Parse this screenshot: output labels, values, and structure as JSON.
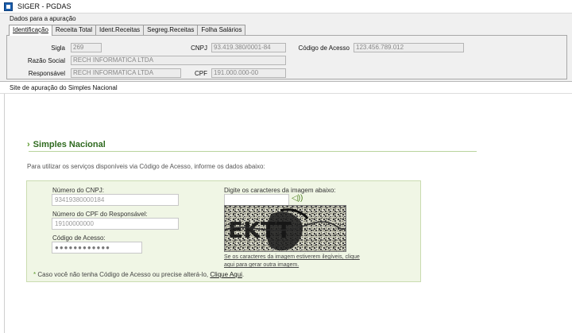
{
  "window": {
    "title": "SIGER - PGDAS"
  },
  "panel": {
    "group_label": "Dados para a apuração",
    "tabs": [
      {
        "label": "Identificação",
        "active": true
      },
      {
        "label": "Receita Total",
        "active": false
      },
      {
        "label": "Ident.Receitas",
        "active": false
      },
      {
        "label": "Segreg.Receitas",
        "active": false
      },
      {
        "label": "Folha Salários",
        "active": false
      }
    ],
    "fields": {
      "sigla": {
        "label": "Sigla",
        "value": "269"
      },
      "cnpj": {
        "label": "CNPJ",
        "value": "93.419.380/0001-84"
      },
      "codigo_acesso": {
        "label": "Código de Acesso",
        "value": "123.456.789.012"
      },
      "razao_social": {
        "label": "Razão Social",
        "value": "RECH INFORMATICA LTDA"
      },
      "responsavel": {
        "label": "Responsável",
        "value": "RECH INFORMATICA LTDA"
      },
      "cpf": {
        "label": "CPF",
        "value": "191.000.000-00"
      }
    }
  },
  "browser": {
    "header": "Site de apuração do Simples Nacional"
  },
  "web": {
    "chevron": "›",
    "title": "Simples Nacional",
    "intro": "Para utilizar os serviços disponíveis via Código de Acesso, informe os dados abaixo:",
    "form": {
      "cnpj_label": "Número do CNPJ:",
      "cnpj_value": "93419380000184",
      "cpf_label": "Número do CPF do Responsável:",
      "cpf_value": "19100000000",
      "codigo_label": "Código de Acesso:",
      "codigo_value": "●●●●●●●●●●●●",
      "captcha_label": "Digite os caracteres da imagem abaixo:",
      "captcha_text": "EKTT",
      "audio_icon": "speaker-icon",
      "audio_glyph": "◁))",
      "illegible_link_1": "Se os caracteres da imagem estiverem ilegíveis, clique",
      "illegible_link_2": "aqui para gerar outra imagem.",
      "note_star": "*",
      "note_text": " Caso você não tenha Código de Acesso ou precise alterá-lo, ",
      "note_link": "Clique Aqui",
      "note_end": "."
    }
  },
  "colors": {
    "accent_green": "#2f6a1f",
    "box_bg": "#f0f6e5"
  }
}
